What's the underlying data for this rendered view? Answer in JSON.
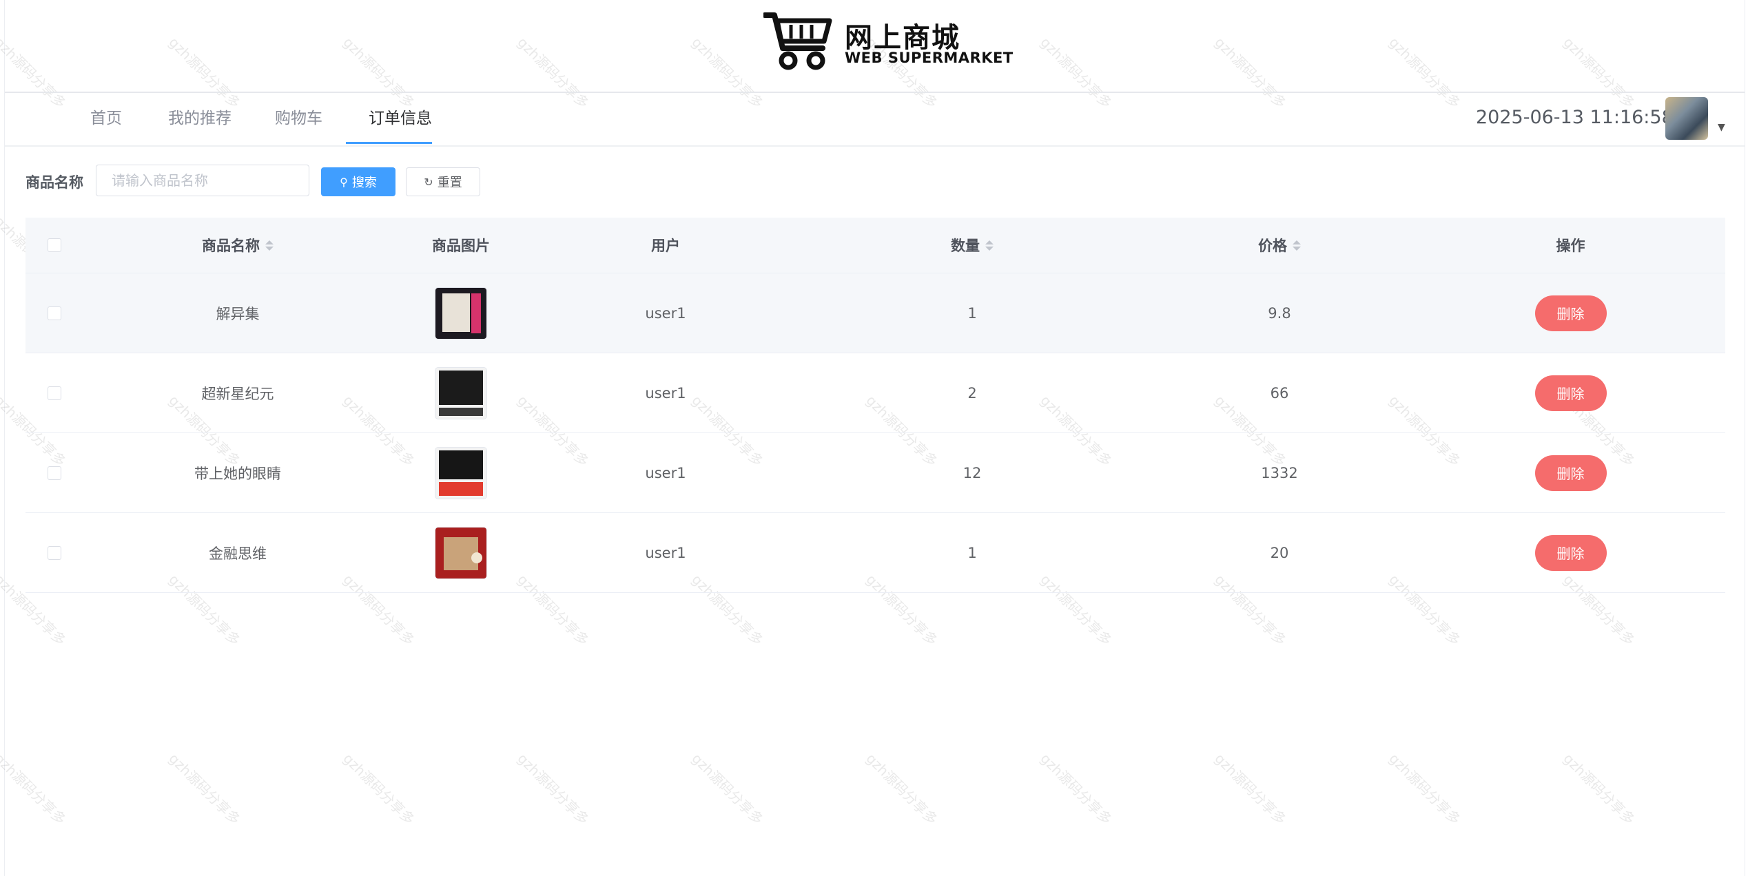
{
  "brand": {
    "title": "网上商城",
    "subtitle": "WEB SUPERMARKET"
  },
  "nav": {
    "items": [
      {
        "label": "首页"
      },
      {
        "label": "我的推荐"
      },
      {
        "label": "购物车"
      },
      {
        "label": "订单信息",
        "active": true
      }
    ],
    "datetime": "2025-06-13 11:16:58"
  },
  "search": {
    "label": "商品名称",
    "placeholder": "请输入商品名称",
    "value": "",
    "search_button": "搜索",
    "reset_button": "重置"
  },
  "table": {
    "columns": [
      "商品名称",
      "商品图片",
      "用户",
      "数量",
      "价格",
      "操作"
    ],
    "rows": [
      {
        "name": "解异集",
        "user": "user1",
        "quantity": "1",
        "price": "9.8",
        "action": "删除"
      },
      {
        "name": "超新星纪元",
        "user": "user1",
        "quantity": "2",
        "price": "66",
        "action": "删除"
      },
      {
        "name": "带上她的眼睛",
        "user": "user1",
        "quantity": "12",
        "price": "1332",
        "action": "删除"
      },
      {
        "name": "金融思维",
        "user": "user1",
        "quantity": "1",
        "price": "20",
        "action": "删除"
      }
    ]
  },
  "watermark": "gzh源码分享多",
  "colors": {
    "primary": "#409eff",
    "danger": "#f56c6c",
    "header_bg": "#f5f7fa"
  }
}
